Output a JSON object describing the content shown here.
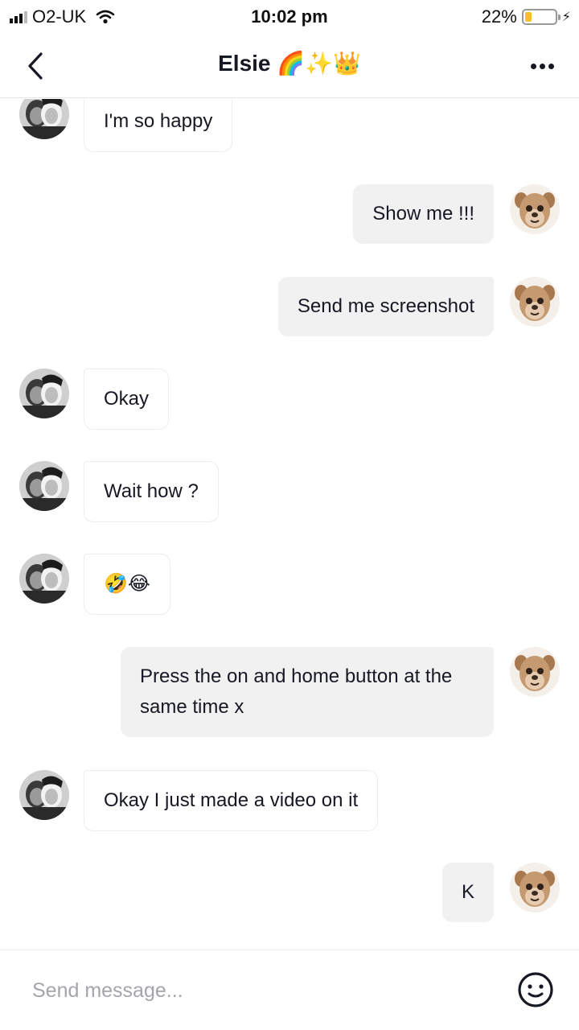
{
  "status_bar": {
    "carrier": "O2-UK",
    "time": "10:02 pm",
    "battery_percent": "22%",
    "battery_level": 0.22,
    "battery_color": "#f7c02b",
    "icons": [
      "signal-icon",
      "wifi-icon",
      "battery-icon",
      "charging-bolt-icon"
    ]
  },
  "header": {
    "title": "Elsie 🌈✨👑",
    "icons": [
      "back-chevron-icon",
      "more-options-icon"
    ]
  },
  "messages": [
    {
      "direction": "in",
      "text": "I'm so happy"
    },
    {
      "direction": "out",
      "text": "Show me !!!"
    },
    {
      "direction": "out",
      "text": "Send me screenshot"
    },
    {
      "direction": "in",
      "text": "Okay"
    },
    {
      "direction": "in",
      "text": "Wait how ?"
    },
    {
      "direction": "in",
      "text": "🤣😂"
    },
    {
      "direction": "out",
      "text": "Press the on and home button at the same time x"
    },
    {
      "direction": "in",
      "text": "Okay I just made a video on it"
    },
    {
      "direction": "out",
      "text": "K"
    }
  ],
  "composer": {
    "placeholder": "Send message...",
    "icons": [
      "emoji-icon"
    ]
  }
}
